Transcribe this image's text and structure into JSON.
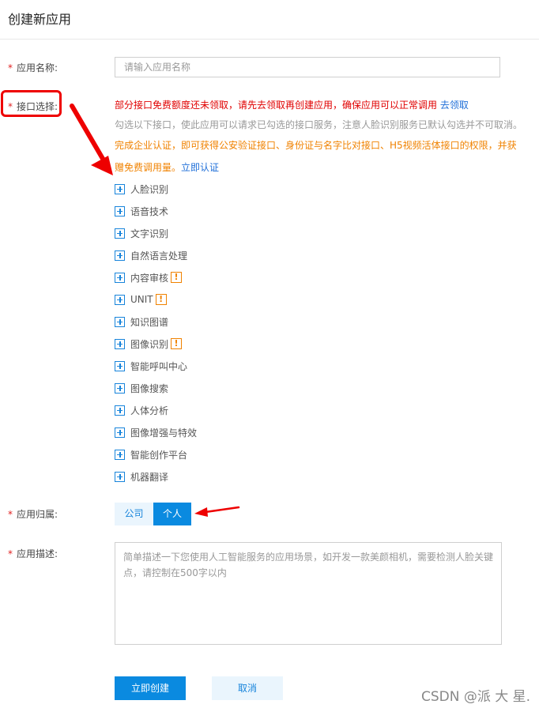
{
  "page": {
    "title": "创建新应用"
  },
  "form": {
    "required_mark": "*",
    "name": {
      "label": "应用名称:",
      "placeholder": "请输入应用名称"
    },
    "api": {
      "label": "接口选择:",
      "notice_red": "部分接口免费额度还未领取，请先去领取再创建应用，确保应用可以正常调用",
      "notice_red_link": "去领取",
      "notice_gray": "勾选以下接口，使此应用可以请求已勾选的接口服务，注意人脸识别服务已默认勾选并不可取消。",
      "notice_orange_line1": "完成企业认证，即可获得公安验证接口、身份证与名字比对接口、H5视频活体接口的权限，并获",
      "notice_orange_line2": "赠免费调用量。",
      "notice_orange_link": "立即认证",
      "warn_glyph": "!",
      "items": [
        {
          "label": "人脸识别",
          "warn": false
        },
        {
          "label": "语音技术",
          "warn": false
        },
        {
          "label": "文字识别",
          "warn": false
        },
        {
          "label": "自然语言处理",
          "warn": false
        },
        {
          "label": "内容审核",
          "warn": true
        },
        {
          "label": "UNIT",
          "warn": true
        },
        {
          "label": "知识图谱",
          "warn": false
        },
        {
          "label": "图像识别",
          "warn": true
        },
        {
          "label": "智能呼叫中心",
          "warn": false
        },
        {
          "label": "图像搜索",
          "warn": false
        },
        {
          "label": "人体分析",
          "warn": false
        },
        {
          "label": "图像增强与特效",
          "warn": false
        },
        {
          "label": "智能创作平台",
          "warn": false
        },
        {
          "label": "机器翻译",
          "warn": false
        }
      ]
    },
    "ownership": {
      "label": "应用归属:",
      "options": [
        "公司",
        "个人"
      ],
      "selected": "个人"
    },
    "description": {
      "label": "应用描述:",
      "placeholder": "简单描述一下您使用人工智能服务的应用场景，如开发一款美颜相机，需要检测人脸关键点，请控制在500字以内"
    },
    "buttons": {
      "create": "立即创建",
      "cancel": "取消"
    }
  },
  "watermark": "CSDN @派 大 星.",
  "colors": {
    "primary": "#0a8ae0",
    "warning": "#f08200",
    "error": "#e00000",
    "annotation": "#e00000"
  }
}
